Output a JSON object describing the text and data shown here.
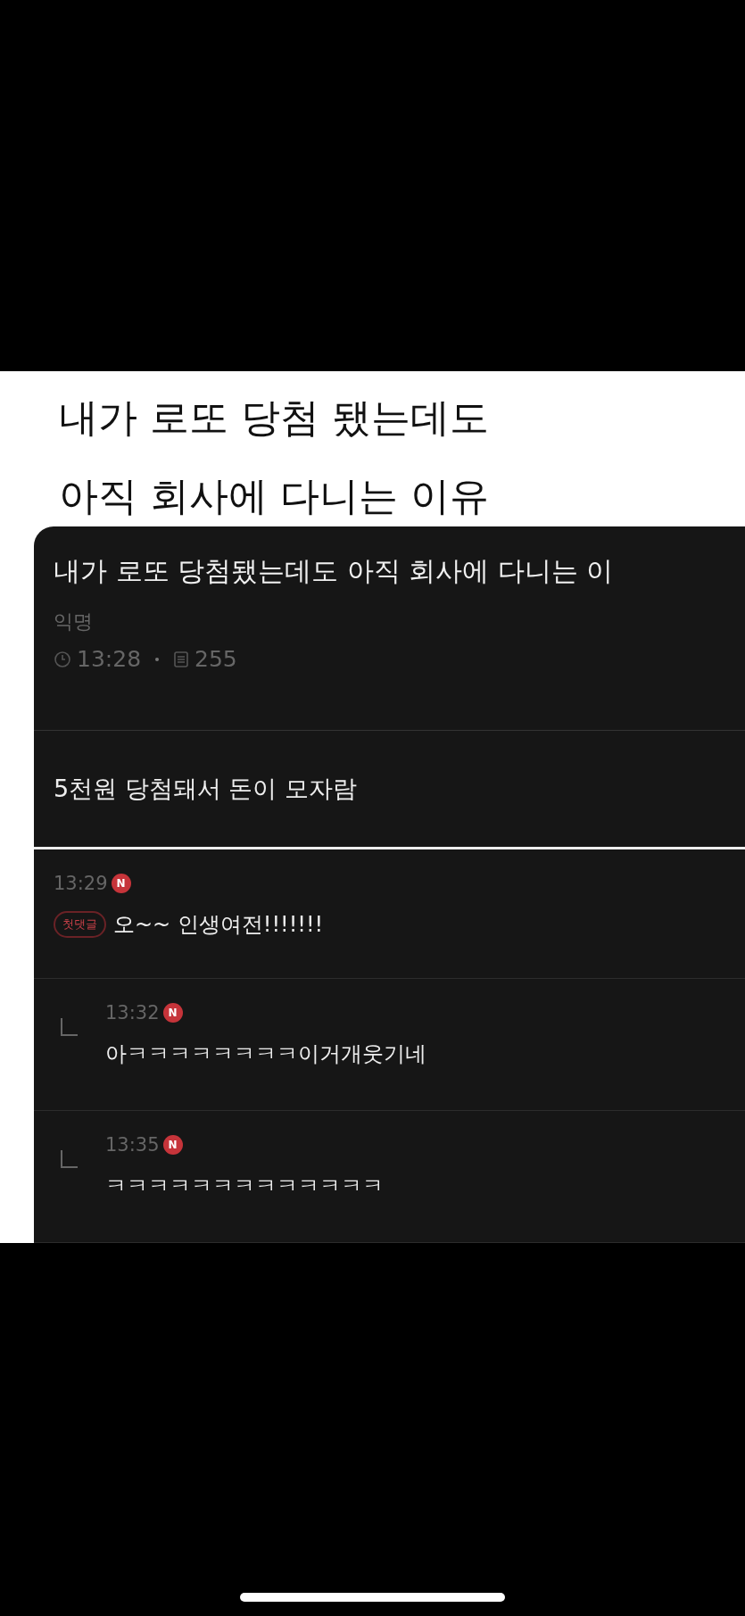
{
  "headline": [
    "내가 로또 당첨 됐는데도",
    "아직 회사에 다니는 이유"
  ],
  "post": {
    "title": "내가 로또 당첨됐는데도 아직 회사에 다니는 이",
    "author": "익명",
    "time": "13:28",
    "views": "255",
    "body": "5천원 당첨돼서 돈이 모자람"
  },
  "comments": [
    {
      "kind": "comment",
      "time": "13:29",
      "badge": "N",
      "tag": "첫댓글",
      "text": "오~~ 인생여전!!!!!!!"
    },
    {
      "kind": "reply",
      "time": "13:32",
      "badge": "N",
      "text": "아ㅋㅋㅋㅋㅋㅋㅋㅋ이거개웃기네"
    },
    {
      "kind": "reply",
      "time": "13:35",
      "badge": "N",
      "text": "ㅋㅋㅋㅋㅋㅋㅋㅋㅋㅋㅋㅋㅋ"
    }
  ]
}
